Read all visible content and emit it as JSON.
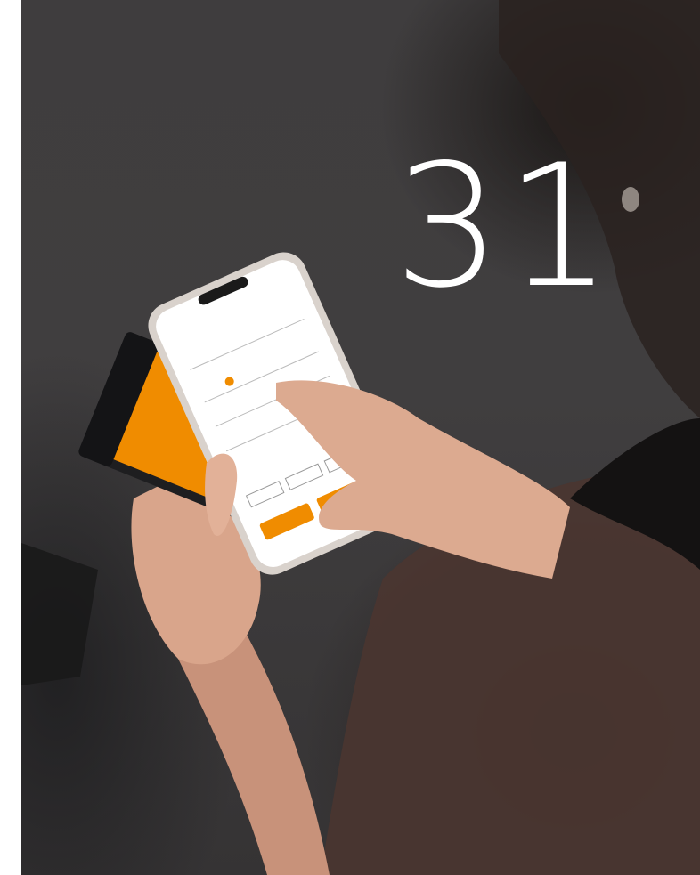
{
  "page": {
    "number": "31"
  },
  "colors": {
    "background": "#3f3d3e",
    "accent_orange": "#f08c00",
    "page_number": "#ffffff",
    "skin": "#d8a88c"
  },
  "photo": {
    "subjects": [
      "hand-held-phone",
      "orange-battery-device",
      "person-silhouette"
    ]
  }
}
